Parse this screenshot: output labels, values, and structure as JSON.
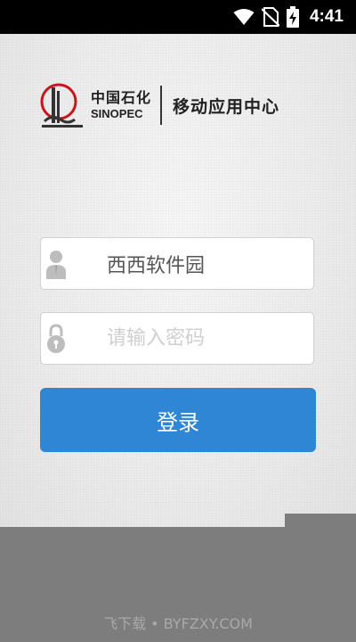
{
  "status_bar": {
    "time": "4:41",
    "icons": [
      "wifi-icon",
      "no-sim-icon",
      "battery-charging-icon"
    ]
  },
  "header": {
    "logo_cn": "中国石化",
    "logo_en": "SINOPEC",
    "app_name": "移动应用中心"
  },
  "login": {
    "username_value": "西西软件园",
    "username_icon": "user-icon",
    "password_placeholder": "请输入密码",
    "password_icon": "lock-icon",
    "submit_label": "登录"
  },
  "watermark": {
    "text": "飞下载 • BYFZXY.COM"
  },
  "colors": {
    "status_bar": "#000000",
    "button": "#2f86d4",
    "bottom_area": "#7d7d7d",
    "logo_red": "#c8161d"
  }
}
